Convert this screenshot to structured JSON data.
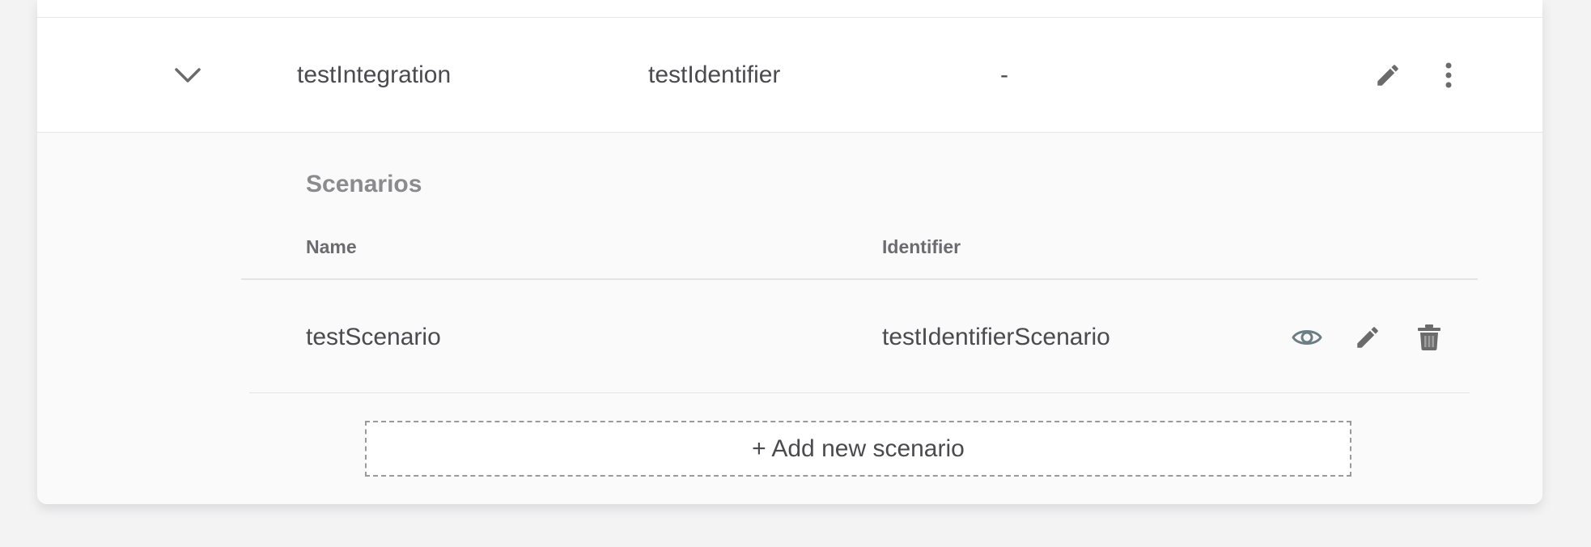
{
  "integration_row": {
    "name": "testIntegration",
    "identifier": "testIdentifier",
    "extra": "-"
  },
  "scenarios": {
    "title": "Scenarios",
    "columns": {
      "name": "Name",
      "identifier": "Identifier"
    },
    "rows": [
      {
        "name": "testScenario",
        "identifier": "testIdentifierScenario"
      }
    ],
    "add_label": "+ Add new scenario"
  },
  "icons": {
    "expand": "chevron-down-icon",
    "edit": "pencil-icon",
    "more": "more-vertical-icon",
    "view": "eye-icon",
    "delete": "trash-icon"
  },
  "colors": {
    "icon_dark": "#6b6b6b",
    "view_icon": "#6b7e86",
    "text": "#4a4a4f",
    "title_muted": "#8a8a8f"
  }
}
